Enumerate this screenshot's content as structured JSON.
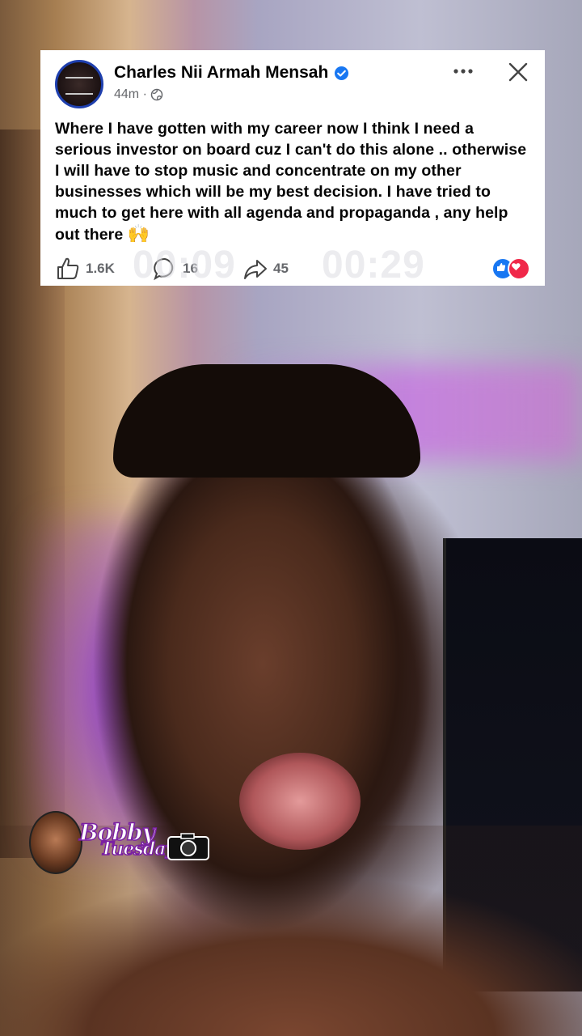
{
  "post": {
    "author": "Charles Nii Armah Mensah",
    "verified_icon": "verified-badge-icon",
    "time": "44m · ",
    "body": "Where I have gotten with my career now I think I need a serious investor on board cuz I can't do this alone .. otherwise I will have to stop music and concentrate on my other businesses which will be my best decision. I have tried to much to get here with all agenda and propaganda , any help out there ",
    "emoji": "🙌",
    "likes": "1.6K",
    "comments": "16",
    "shares": "45"
  },
  "video": {
    "elapsed": "00:09",
    "duration": "00:29"
  },
  "watermark": {
    "line1": "Bobby",
    "line2": "Tuesday"
  },
  "colors": {
    "accent": "#1877f2",
    "love": "#f02849",
    "watermark_stroke": "#7a1fa3"
  }
}
